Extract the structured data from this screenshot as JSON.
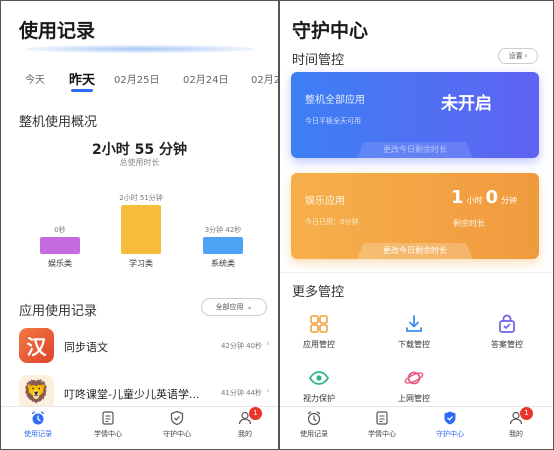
{
  "colors": {
    "accent": "#2f6cf6",
    "entertainment": "#c66ae0",
    "study": "#f5bd3b",
    "system": "#4da2f4",
    "badge": "#e9352b",
    "blue_card": "#4a74f3",
    "orange_card": "#f3a545"
  },
  "left": {
    "title": "使用记录",
    "dates": [
      "今天",
      "昨天",
      "02月25日",
      "02月24日",
      "02月2"
    ],
    "selected_date_index": 1,
    "overview_title": "整机使用概况",
    "total_value": "2小时 55 分钟",
    "total_label": "总使用时长",
    "chart_data": {
      "type": "bar",
      "categories": [
        "娱乐类",
        "学习类",
        "系统类"
      ],
      "value_labels": [
        "0秒",
        "2小时 51分钟",
        "3分钟 42秒"
      ],
      "values_seconds": [
        0,
        10260,
        222
      ]
    },
    "app_usage_title": "应用使用记录",
    "filter_label": "全部应用",
    "apps": [
      {
        "name": "同步语文",
        "time": "42分钟 40秒",
        "icon": "chinese-char-icon",
        "icon_char": "汉"
      },
      {
        "name": "叮咚课堂-儿童少儿英语学...",
        "time": "41分钟 44秒",
        "icon": "lion-icon",
        "icon_char": "🦁"
      }
    ],
    "nav": [
      {
        "label": "使用记录",
        "icon": "alarm-clock-icon"
      },
      {
        "label": "学情中心",
        "icon": "report-icon"
      },
      {
        "label": "守护中心",
        "icon": "shield-icon"
      },
      {
        "label": "我的",
        "icon": "user-icon",
        "badge": "1"
      }
    ]
  },
  "right": {
    "title": "守护中心",
    "time_control_title": "时间管控",
    "settings_label": "设置",
    "card_device": {
      "label": "整机全部应用",
      "status": "未开启",
      "sub": "今日平板全天可用",
      "action": "更改今日剩余时长"
    },
    "card_entertainment": {
      "label": "娱乐应用",
      "hours": "1",
      "hour_unit": "小时",
      "minutes": "0",
      "minute_unit": "分钟",
      "used": "今日已用：0分钟",
      "remain": "剩余时长",
      "action": "更改今日剩余时长"
    },
    "more_title": "更多管控",
    "controls": [
      {
        "label": "应用管控",
        "icon": "grid-apps-icon"
      },
      {
        "label": "下载管控",
        "icon": "download-icon"
      },
      {
        "label": "答案管控",
        "icon": "lock-bag-icon"
      },
      {
        "label": "视力保护",
        "icon": "eye-icon"
      },
      {
        "label": "上网管控",
        "icon": "planet-icon"
      }
    ],
    "nav": [
      {
        "label": "使用记录",
        "icon": "alarm-clock-icon"
      },
      {
        "label": "学情中心",
        "icon": "report-icon"
      },
      {
        "label": "守护中心",
        "icon": "shield-icon"
      },
      {
        "label": "我的",
        "icon": "user-icon",
        "badge": "1"
      }
    ]
  }
}
